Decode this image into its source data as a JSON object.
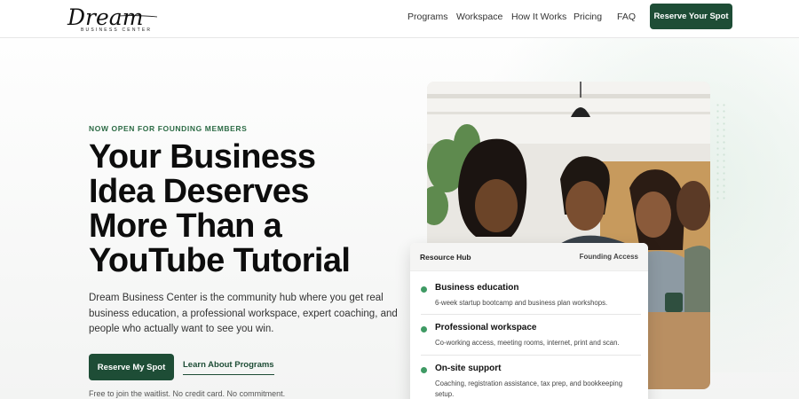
{
  "header": {
    "logo_text": "Dream",
    "logo_sub": "BUSINESS CENTER",
    "nav": [
      "Programs",
      "Workspace",
      "How It Works",
      "Pricing",
      "FAQ"
    ],
    "cta": "Reserve Your Spot"
  },
  "hero": {
    "eyebrow": "NOW OPEN FOR FOUNDING MEMBERS",
    "headline_lines": [
      "Your Business",
      "Idea Deserves",
      "More Than a",
      "YouTube Tutorial"
    ],
    "lede": "Dream Business Center is the community hub where you get real business education, a professional workspace, expert coaching, and people who actually want to see you win.",
    "primary_button": "Reserve My Spot",
    "secondary_link": "Learn About Programs",
    "note": "Free to join the waitlist. No credit card. No commitment."
  },
  "card": {
    "title": "Resource Hub",
    "tag": "Founding Access",
    "items": [
      {
        "title": "Business education",
        "desc": "6-week startup bootcamp and business plan workshops."
      },
      {
        "title": "Professional workspace",
        "desc": "Co-working access, meeting rooms, internet, print and scan."
      },
      {
        "title": "On-site support",
        "desc": "Coaching, registration assistance, tax prep, and bookkeeping setup."
      }
    ]
  },
  "colors": {
    "brand": "#1e4d36",
    "accent": "#3f9a64",
    "eyebrow": "#2c6b45"
  }
}
